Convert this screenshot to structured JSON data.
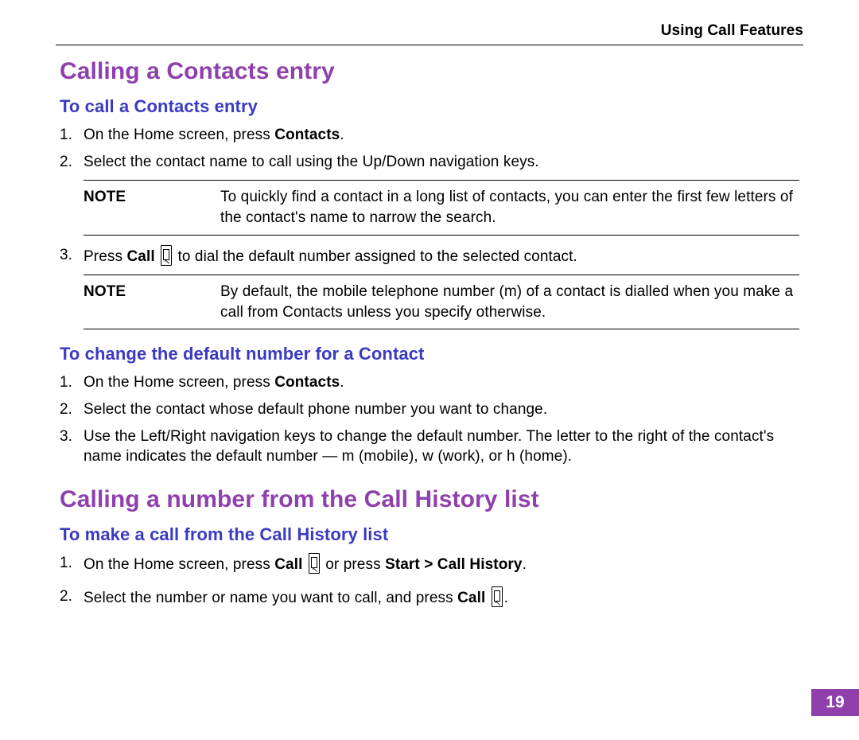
{
  "runningHead": "Using Call Features",
  "h1_1": "Calling a Contacts entry",
  "sub1": "To call a Contacts entry",
  "s1": {
    "i1a": "On the Home screen, press ",
    "i1b": "Contacts",
    "i1c": ".",
    "i2": "Select the contact name to call using the Up/Down navigation keys."
  },
  "note1": {
    "label": "NOTE",
    "body": "To quickly find a contact in a long list of contacts, you can enter the first few letters of the contact's name to narrow the search."
  },
  "s3": {
    "a": "Press ",
    "b": "Call",
    "c": " to dial the default number assigned to the selected contact."
  },
  "note2": {
    "label": "NOTE",
    "body": "By default, the mobile telephone number (m) of a contact is dialled when you make a call from Contacts unless you specify otherwise."
  },
  "sub2": "To change the default number for a Contact",
  "s2_1a": "On the Home screen, press ",
  "s2_1b": "Contacts",
  "s2_1c": ".",
  "s2_2": "Select the contact whose default phone number you want to change.",
  "s2_3": "Use the Left/Right navigation keys to change the default number. The letter to the right of the contact's name indicates the default number — m (mobile), w (work), or h (home).",
  "h1_2": "Calling a number from the Call History list",
  "sub3": "To make a call from the Call History list",
  "s3_1a": "On the Home screen, press ",
  "s3_1b": "Call",
  "s3_1c": " or press ",
  "s3_1d": "Start  > Call History",
  "s3_1e": ".",
  "s3_2a": "Select the number or name you want to call, and press ",
  "s3_2b": "Call",
  "s3_2c": ".",
  "pageNumber": "19"
}
